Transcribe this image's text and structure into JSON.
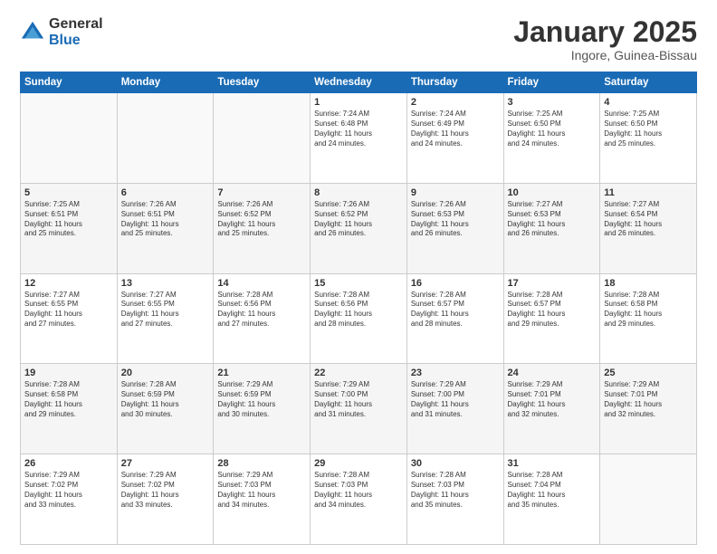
{
  "logo": {
    "general": "General",
    "blue": "Blue"
  },
  "title": "January 2025",
  "subtitle": "Ingore, Guinea-Bissau",
  "days_of_week": [
    "Sunday",
    "Monday",
    "Tuesday",
    "Wednesday",
    "Thursday",
    "Friday",
    "Saturday"
  ],
  "weeks": [
    [
      {
        "day": "",
        "info": ""
      },
      {
        "day": "",
        "info": ""
      },
      {
        "day": "",
        "info": ""
      },
      {
        "day": "1",
        "info": "Sunrise: 7:24 AM\nSunset: 6:48 PM\nDaylight: 11 hours\nand 24 minutes."
      },
      {
        "day": "2",
        "info": "Sunrise: 7:24 AM\nSunset: 6:49 PM\nDaylight: 11 hours\nand 24 minutes."
      },
      {
        "day": "3",
        "info": "Sunrise: 7:25 AM\nSunset: 6:50 PM\nDaylight: 11 hours\nand 24 minutes."
      },
      {
        "day": "4",
        "info": "Sunrise: 7:25 AM\nSunset: 6:50 PM\nDaylight: 11 hours\nand 25 minutes."
      }
    ],
    [
      {
        "day": "5",
        "info": "Sunrise: 7:25 AM\nSunset: 6:51 PM\nDaylight: 11 hours\nand 25 minutes."
      },
      {
        "day": "6",
        "info": "Sunrise: 7:26 AM\nSunset: 6:51 PM\nDaylight: 11 hours\nand 25 minutes."
      },
      {
        "day": "7",
        "info": "Sunrise: 7:26 AM\nSunset: 6:52 PM\nDaylight: 11 hours\nand 25 minutes."
      },
      {
        "day": "8",
        "info": "Sunrise: 7:26 AM\nSunset: 6:52 PM\nDaylight: 11 hours\nand 26 minutes."
      },
      {
        "day": "9",
        "info": "Sunrise: 7:26 AM\nSunset: 6:53 PM\nDaylight: 11 hours\nand 26 minutes."
      },
      {
        "day": "10",
        "info": "Sunrise: 7:27 AM\nSunset: 6:53 PM\nDaylight: 11 hours\nand 26 minutes."
      },
      {
        "day": "11",
        "info": "Sunrise: 7:27 AM\nSunset: 6:54 PM\nDaylight: 11 hours\nand 26 minutes."
      }
    ],
    [
      {
        "day": "12",
        "info": "Sunrise: 7:27 AM\nSunset: 6:55 PM\nDaylight: 11 hours\nand 27 minutes."
      },
      {
        "day": "13",
        "info": "Sunrise: 7:27 AM\nSunset: 6:55 PM\nDaylight: 11 hours\nand 27 minutes."
      },
      {
        "day": "14",
        "info": "Sunrise: 7:28 AM\nSunset: 6:56 PM\nDaylight: 11 hours\nand 27 minutes."
      },
      {
        "day": "15",
        "info": "Sunrise: 7:28 AM\nSunset: 6:56 PM\nDaylight: 11 hours\nand 28 minutes."
      },
      {
        "day": "16",
        "info": "Sunrise: 7:28 AM\nSunset: 6:57 PM\nDaylight: 11 hours\nand 28 minutes."
      },
      {
        "day": "17",
        "info": "Sunrise: 7:28 AM\nSunset: 6:57 PM\nDaylight: 11 hours\nand 29 minutes."
      },
      {
        "day": "18",
        "info": "Sunrise: 7:28 AM\nSunset: 6:58 PM\nDaylight: 11 hours\nand 29 minutes."
      }
    ],
    [
      {
        "day": "19",
        "info": "Sunrise: 7:28 AM\nSunset: 6:58 PM\nDaylight: 11 hours\nand 29 minutes."
      },
      {
        "day": "20",
        "info": "Sunrise: 7:28 AM\nSunset: 6:59 PM\nDaylight: 11 hours\nand 30 minutes."
      },
      {
        "day": "21",
        "info": "Sunrise: 7:29 AM\nSunset: 6:59 PM\nDaylight: 11 hours\nand 30 minutes."
      },
      {
        "day": "22",
        "info": "Sunrise: 7:29 AM\nSunset: 7:00 PM\nDaylight: 11 hours\nand 31 minutes."
      },
      {
        "day": "23",
        "info": "Sunrise: 7:29 AM\nSunset: 7:00 PM\nDaylight: 11 hours\nand 31 minutes."
      },
      {
        "day": "24",
        "info": "Sunrise: 7:29 AM\nSunset: 7:01 PM\nDaylight: 11 hours\nand 32 minutes."
      },
      {
        "day": "25",
        "info": "Sunrise: 7:29 AM\nSunset: 7:01 PM\nDaylight: 11 hours\nand 32 minutes."
      }
    ],
    [
      {
        "day": "26",
        "info": "Sunrise: 7:29 AM\nSunset: 7:02 PM\nDaylight: 11 hours\nand 33 minutes."
      },
      {
        "day": "27",
        "info": "Sunrise: 7:29 AM\nSunset: 7:02 PM\nDaylight: 11 hours\nand 33 minutes."
      },
      {
        "day": "28",
        "info": "Sunrise: 7:29 AM\nSunset: 7:03 PM\nDaylight: 11 hours\nand 34 minutes."
      },
      {
        "day": "29",
        "info": "Sunrise: 7:28 AM\nSunset: 7:03 PM\nDaylight: 11 hours\nand 34 minutes."
      },
      {
        "day": "30",
        "info": "Sunrise: 7:28 AM\nSunset: 7:03 PM\nDaylight: 11 hours\nand 35 minutes."
      },
      {
        "day": "31",
        "info": "Sunrise: 7:28 AM\nSunset: 7:04 PM\nDaylight: 11 hours\nand 35 minutes."
      },
      {
        "day": "",
        "info": ""
      }
    ]
  ]
}
